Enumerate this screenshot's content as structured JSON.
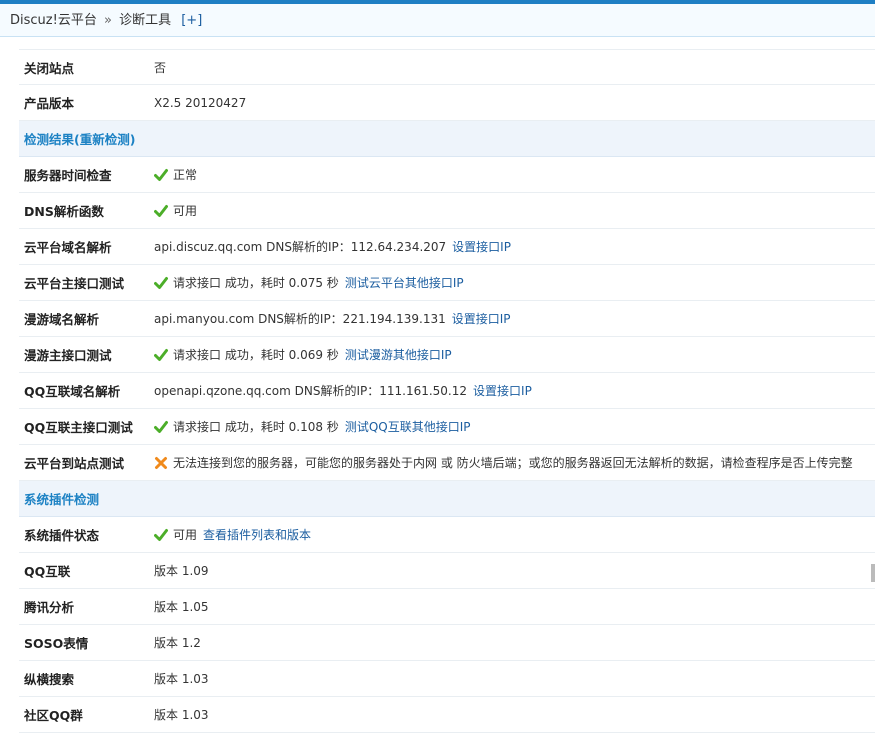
{
  "breadcrumb": {
    "root": "Discuz!云平台",
    "sep": "»",
    "current": "诊断工具",
    "expand": "[+]"
  },
  "rows": [
    {
      "type": "row",
      "label": "关闭站点",
      "value": "否"
    },
    {
      "type": "row",
      "label": "产品版本",
      "value": "X2.5 20120427"
    },
    {
      "type": "section",
      "title": "检测结果(重新检测)"
    },
    {
      "type": "row",
      "label": "服务器时间检查",
      "status": "ok",
      "value": "正常"
    },
    {
      "type": "row",
      "label": "DNS解析函数",
      "status": "ok",
      "value": "可用"
    },
    {
      "type": "row",
      "label": "云平台域名解析",
      "value": "api.discuz.qq.com DNS解析的IP：112.64.234.207",
      "link": "设置接口IP"
    },
    {
      "type": "row",
      "label": "云平台主接口测试",
      "status": "ok",
      "value": "请求接口 成功，耗时 0.075 秒",
      "link": "测试云平台其他接口IP"
    },
    {
      "type": "row",
      "label": "漫游域名解析",
      "value": "api.manyou.com DNS解析的IP：221.194.139.131",
      "link": "设置接口IP"
    },
    {
      "type": "row",
      "label": "漫游主接口测试",
      "status": "ok",
      "value": "请求接口 成功，耗时 0.069 秒",
      "link": "测试漫游其他接口IP"
    },
    {
      "type": "row",
      "label": "QQ互联域名解析",
      "value": "openapi.qzone.qq.com DNS解析的IP：111.161.50.12",
      "link": "设置接口IP"
    },
    {
      "type": "row",
      "label": "QQ互联主接口测试",
      "status": "ok",
      "value": "请求接口 成功，耗时 0.108 秒",
      "link": "测试QQ互联其他接口IP"
    },
    {
      "type": "row",
      "label": "云平台到站点测试",
      "status": "error",
      "value": "无法连接到您的服务器，可能您的服务器处于内网 或 防火墙后端；或您的服务器返回无法解析的数据，请检查程序是否上传完整"
    },
    {
      "type": "section",
      "title": "系统插件检测"
    },
    {
      "type": "row",
      "label": "系统插件状态",
      "status": "ok",
      "value": "可用",
      "link": "查看插件列表和版本"
    },
    {
      "type": "row",
      "label": "QQ互联",
      "value": "版本 1.09"
    },
    {
      "type": "row",
      "label": "腾讯分析",
      "value": "版本 1.05"
    },
    {
      "type": "row",
      "label": "SOSO表情",
      "value": "版本 1.2"
    },
    {
      "type": "row",
      "label": "纵横搜索",
      "value": "版本 1.03"
    },
    {
      "type": "row",
      "label": "社区QQ群",
      "value": "版本 1.03"
    }
  ],
  "colors": {
    "accent": "#1e7fc4",
    "link": "#1c5ea0",
    "ok": "#4cae29",
    "error": "#f08a1c",
    "section_bg": "#eef4fb"
  }
}
